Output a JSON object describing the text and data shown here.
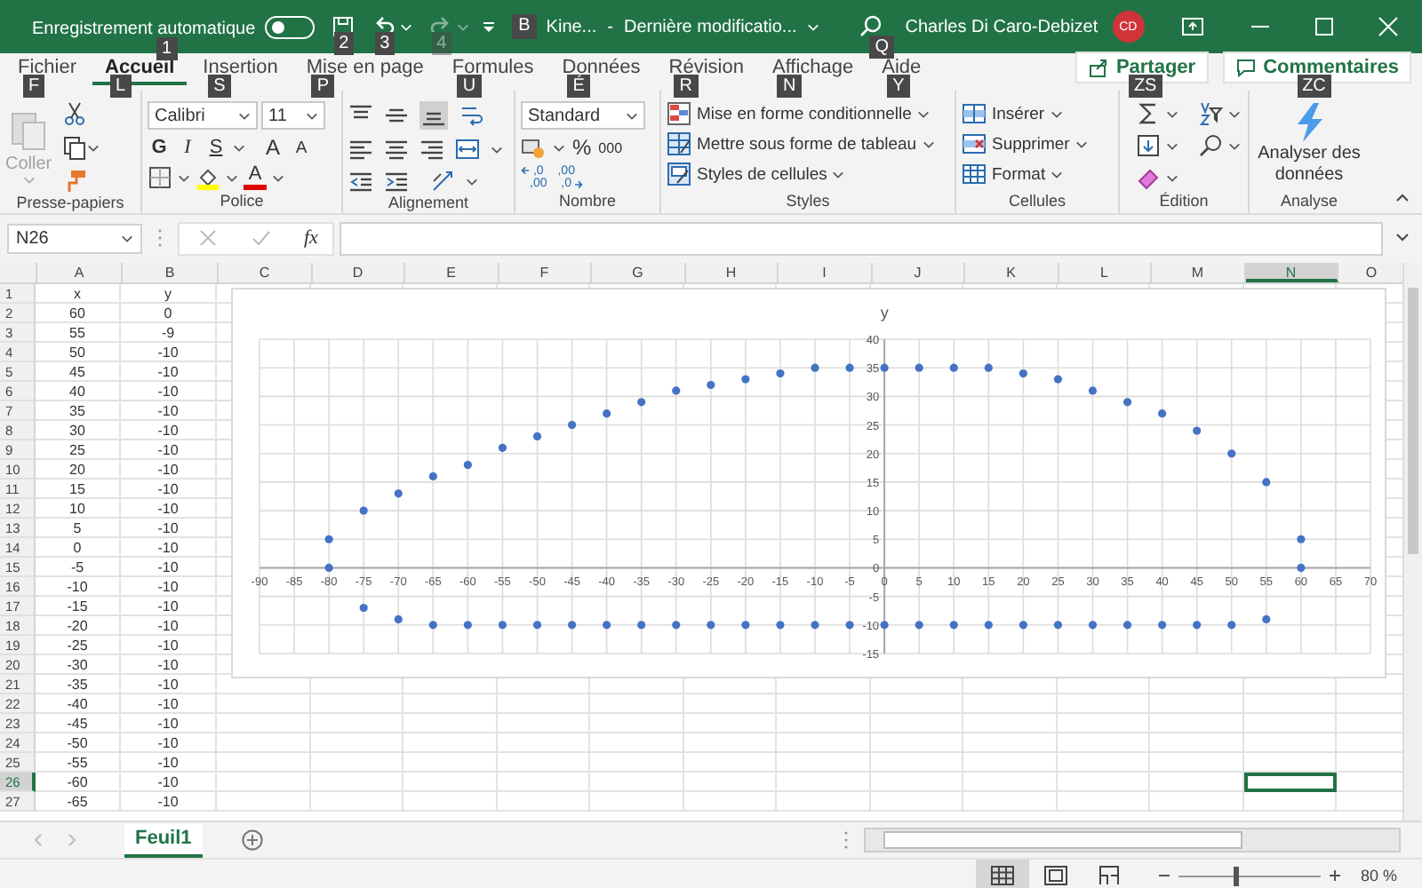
{
  "title_bar": {
    "autosave": {
      "label": "Enregistrement automatique",
      "on": false,
      "key_tip": "1"
    },
    "quick_access": [
      {
        "kind": "save",
        "key_tip": "2",
        "disabled": false
      },
      {
        "kind": "undo",
        "key_tip": "3",
        "disabled": false
      },
      {
        "kind": "redo",
        "key_tip": "4",
        "disabled": true
      }
    ],
    "file": {
      "key_tip": "B",
      "name": "Kine...",
      "separator": "-",
      "status": "Dernière modificatio..."
    },
    "search": {
      "key_tip": "Q"
    },
    "user": {
      "name": "Charles Di Caro-Debizet",
      "initials": "CD"
    }
  },
  "tabs": [
    {
      "label": "Fichier",
      "key_tip": "F",
      "selected": false
    },
    {
      "label": "Accueil",
      "key_tip": "L",
      "selected": true
    },
    {
      "label": "Insertion",
      "key_tip": "S",
      "selected": false
    },
    {
      "label": "Mise en page",
      "key_tip": "P",
      "selected": false
    },
    {
      "label": "Formules",
      "key_tip": "U",
      "selected": false
    },
    {
      "label": "Données",
      "key_tip": "É",
      "selected": false
    },
    {
      "label": "Révision",
      "key_tip": "R",
      "selected": false
    },
    {
      "label": "Affichage",
      "key_tip": "N",
      "selected": false
    },
    {
      "label": "Aide",
      "key_tip": "Y",
      "selected": false
    }
  ],
  "share": {
    "label": "Partager",
    "key_tip": "ZS"
  },
  "comments": {
    "label": "Commentaires",
    "key_tip": "ZC"
  },
  "ribbon": {
    "clipboard": {
      "label": "Presse-papiers",
      "paste": {
        "label": "Coller",
        "disabled": true
      }
    },
    "font": {
      "label": "Police",
      "family": "Calibri",
      "size": "11",
      "styles": [
        "G",
        "I",
        "S"
      ],
      "grow": "A",
      "shrink": "A",
      "color_letter": "A"
    },
    "alignment": {
      "label": "Alignement"
    },
    "number": {
      "label": "Nombre",
      "format": "Standard",
      "percent": "%",
      "thousands": "000",
      "decimals": [
        {
          "kind": "increase",
          "top": ",0",
          "bottom": ",00"
        },
        {
          "kind": "decrease",
          "top": ",00",
          "bottom": ",0"
        }
      ]
    },
    "styles": {
      "label": "Styles",
      "items": [
        {
          "kind": "conditional",
          "label": "Mise en forme conditionnelle"
        },
        {
          "kind": "table",
          "label": "Mettre sous forme de tableau"
        },
        {
          "kind": "cell_styles",
          "label": "Styles de cellules"
        }
      ]
    },
    "cells": {
      "label": "Cellules",
      "items": [
        {
          "kind": "insert",
          "label": "Insérer"
        },
        {
          "kind": "delete",
          "label": "Supprimer"
        },
        {
          "kind": "format",
          "label": "Format"
        }
      ]
    },
    "editing": {
      "label": "Édition"
    },
    "analysis": {
      "label": "Analyse",
      "button": "Analyser des données"
    }
  },
  "formula_bar": {
    "name_box": "N26",
    "fx": "fx"
  },
  "sheet": {
    "columns": [
      {
        "label": "A",
        "selected": false
      },
      {
        "label": "B",
        "selected": false
      },
      {
        "label": "C",
        "selected": false
      },
      {
        "label": "D",
        "selected": false
      },
      {
        "label": "E",
        "selected": false
      },
      {
        "label": "F",
        "selected": false
      },
      {
        "label": "G",
        "selected": false
      },
      {
        "label": "H",
        "selected": false
      },
      {
        "label": "I",
        "selected": false
      },
      {
        "label": "J",
        "selected": false
      },
      {
        "label": "K",
        "selected": false
      },
      {
        "label": "L",
        "selected": false
      },
      {
        "label": "M",
        "selected": false
      },
      {
        "label": "N",
        "selected": true
      },
      {
        "label": "O",
        "selected": false
      }
    ],
    "rows": [
      {
        "number": "1",
        "selected": false,
        "cells": [
          "x",
          "y"
        ]
      },
      {
        "number": "2",
        "selected": false,
        "cells": [
          "60",
          "0"
        ]
      },
      {
        "number": "3",
        "selected": false,
        "cells": [
          "55",
          "-9"
        ]
      },
      {
        "number": "4",
        "selected": false,
        "cells": [
          "50",
          "-10"
        ]
      },
      {
        "number": "5",
        "selected": false,
        "cells": [
          "45",
          "-10"
        ]
      },
      {
        "number": "6",
        "selected": false,
        "cells": [
          "40",
          "-10"
        ]
      },
      {
        "number": "7",
        "selected": false,
        "cells": [
          "35",
          "-10"
        ]
      },
      {
        "number": "8",
        "selected": false,
        "cells": [
          "30",
          "-10"
        ]
      },
      {
        "number": "9",
        "selected": false,
        "cells": [
          "25",
          "-10"
        ]
      },
      {
        "number": "10",
        "selected": false,
        "cells": [
          "20",
          "-10"
        ]
      },
      {
        "number": "11",
        "selected": false,
        "cells": [
          "15",
          "-10"
        ]
      },
      {
        "number": "12",
        "selected": false,
        "cells": [
          "10",
          "-10"
        ]
      },
      {
        "number": "13",
        "selected": false,
        "cells": [
          "5",
          "-10"
        ]
      },
      {
        "number": "14",
        "selected": false,
        "cells": [
          "0",
          "-10"
        ]
      },
      {
        "number": "15",
        "selected": false,
        "cells": [
          "-5",
          "-10"
        ]
      },
      {
        "number": "16",
        "selected": false,
        "cells": [
          "-10",
          "-10"
        ]
      },
      {
        "number": "17",
        "selected": false,
        "cells": [
          "-15",
          "-10"
        ]
      },
      {
        "number": "18",
        "selected": false,
        "cells": [
          "-20",
          "-10"
        ]
      },
      {
        "number": "19",
        "selected": false,
        "cells": [
          "-25",
          "-10"
        ]
      },
      {
        "number": "20",
        "selected": false,
        "cells": [
          "-30",
          "-10"
        ]
      },
      {
        "number": "21",
        "selected": false,
        "cells": [
          "-35",
          "-10"
        ]
      },
      {
        "number": "22",
        "selected": false,
        "cells": [
          "-40",
          "-10"
        ]
      },
      {
        "number": "23",
        "selected": false,
        "cells": [
          "-45",
          "-10"
        ]
      },
      {
        "number": "24",
        "selected": false,
        "cells": [
          "-50",
          "-10"
        ]
      },
      {
        "number": "25",
        "selected": false,
        "cells": [
          "-55",
          "-10"
        ]
      },
      {
        "number": "26",
        "selected": true,
        "cells": [
          "-60",
          "-10"
        ]
      },
      {
        "number": "27",
        "selected": false,
        "cells": [
          "-65",
          "-10"
        ]
      }
    ],
    "chart_data": {
      "type": "scatter",
      "title": "y",
      "x": [
        60,
        55,
        50,
        45,
        40,
        35,
        30,
        25,
        20,
        15,
        10,
        5,
        0,
        -5,
        -10,
        -15,
        -20,
        -25,
        -30,
        -35,
        -40,
        -45,
        -50,
        -55,
        -60,
        -65,
        -70,
        -75,
        -80,
        -80,
        -75,
        -70,
        -65,
        -60,
        -55,
        -50,
        -45,
        -40,
        -35,
        -30,
        -25,
        -20,
        -15,
        -10,
        -5,
        0,
        5,
        10,
        15,
        20,
        25,
        30,
        35,
        40,
        45,
        50,
        55,
        60
      ],
      "grid": true,
      "series": [
        {
          "color": "#4472c4",
          "values": [
            0,
            -9,
            -10,
            -10,
            -10,
            -10,
            -10,
            -10,
            -10,
            -10,
            -10,
            -10,
            -10,
            -10,
            -10,
            -10,
            -10,
            -10,
            -10,
            -10,
            -10,
            -10,
            -10,
            -10,
            -10,
            -10,
            -9,
            -7,
            0,
            5,
            10,
            13,
            16,
            18,
            21,
            23,
            25,
            27,
            29,
            31,
            32,
            33,
            34,
            35,
            35,
            35,
            35,
            35,
            35,
            34,
            33,
            31,
            29,
            27,
            24,
            20,
            15,
            5
          ]
        }
      ],
      "xlim": [
        -90,
        70
      ],
      "ylim": [
        -15,
        40
      ],
      "xticks": [
        -90,
        -85,
        -80,
        -75,
        -70,
        -65,
        -60,
        -55,
        -50,
        -45,
        -40,
        -35,
        -30,
        -25,
        -20,
        -15,
        -10,
        -5,
        0,
        5,
        10,
        15,
        20,
        25,
        30,
        35,
        40,
        45,
        50,
        55,
        60,
        65,
        70
      ],
      "yticks": [
        -15,
        -10,
        -5,
        0,
        5,
        10,
        15,
        20,
        25,
        30,
        35,
        40
      ]
    }
  },
  "sheet_tabs": [
    {
      "label": "Feuil1",
      "selected": true
    }
  ],
  "status_bar": {
    "views": [
      {
        "kind": "normal",
        "selected": true
      },
      {
        "kind": "page_layout",
        "selected": false
      },
      {
        "kind": "page_break",
        "selected": false
      }
    ],
    "zoom": {
      "level": 0.4,
      "label": "80 %"
    }
  }
}
